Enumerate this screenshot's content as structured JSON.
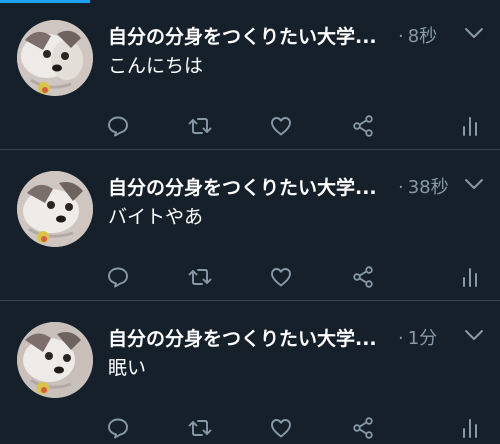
{
  "colors": {
    "background": "#15202b",
    "divider": "#38444d",
    "text_primary": "#ffffff",
    "text_secondary": "#8899a6",
    "accent": "#1da1f2"
  },
  "tweets": [
    {
      "display_name": "自分の分身をつくりたい大学...",
      "separator": "·",
      "time": "8秒",
      "text": "こんにちは"
    },
    {
      "display_name": "自分の分身をつくりたい大学...",
      "separator": "·",
      "time": "38秒",
      "text": "バイトやあ"
    },
    {
      "display_name": "自分の分身をつくりたい大学...",
      "separator": "·",
      "time": "1分",
      "text": "眠い"
    }
  ],
  "icons": {
    "reply": "reply-icon",
    "retweet": "retweet-icon",
    "like": "heart-icon",
    "share": "share-icon",
    "stats": "stats-icon",
    "more": "chevron-down-icon"
  }
}
